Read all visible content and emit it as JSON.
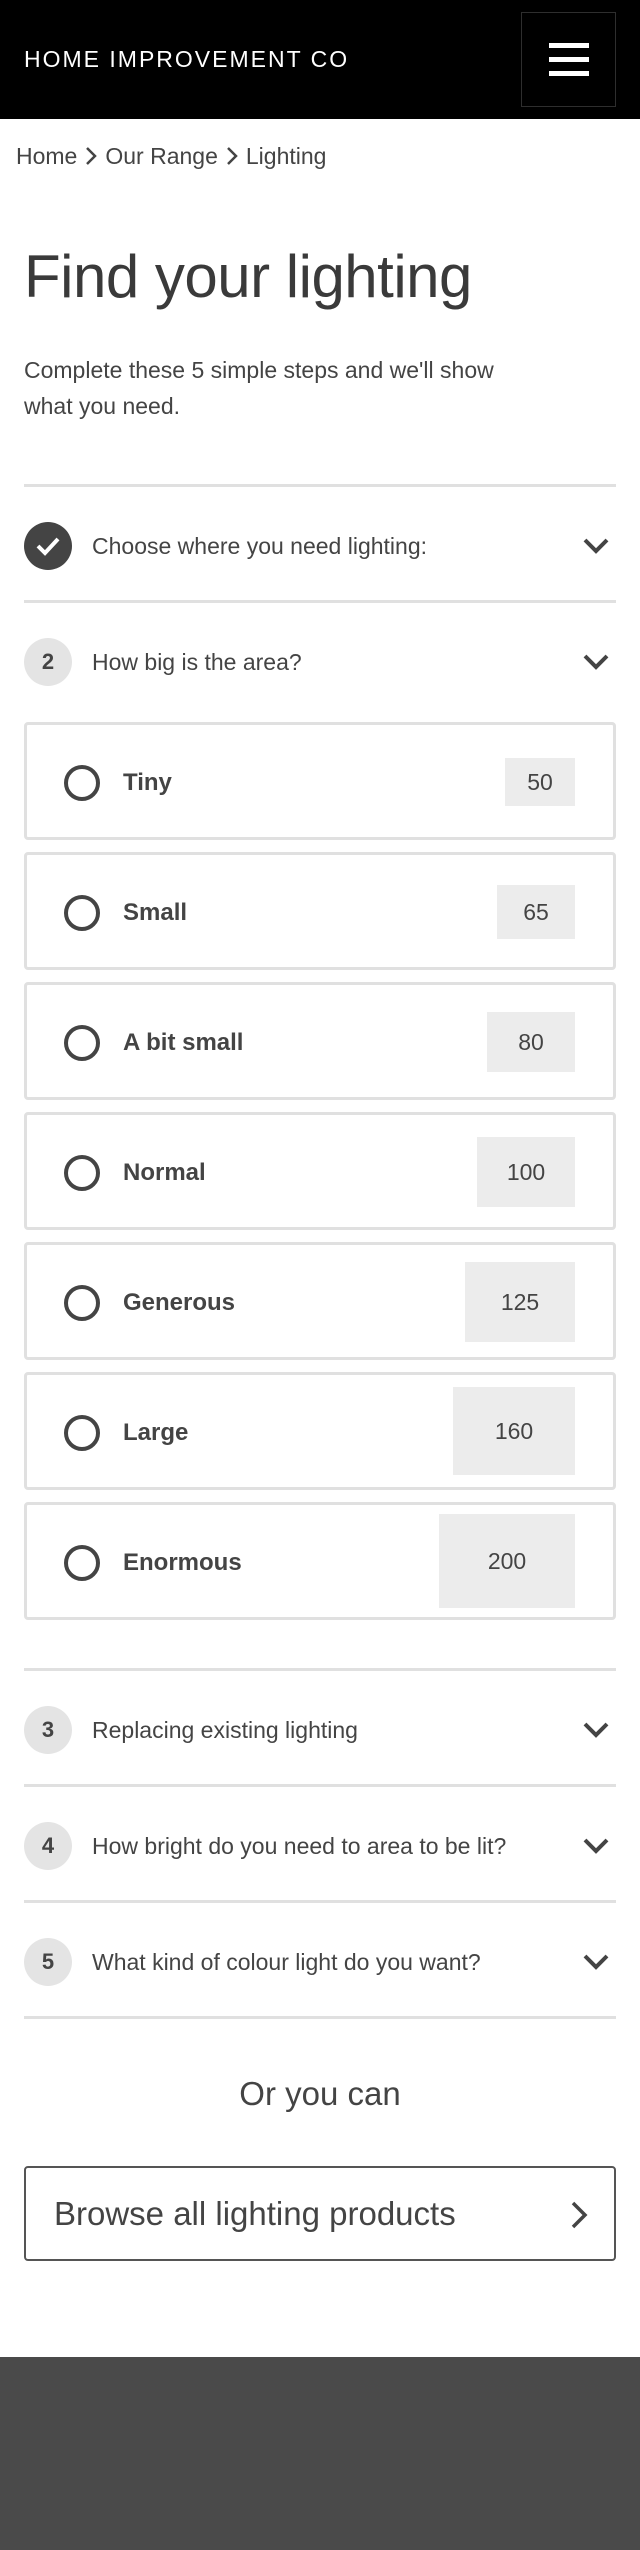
{
  "header": {
    "brand": "HOME IMPROVEMENT CO",
    "menu_icon": "hamburger-menu-icon"
  },
  "breadcrumb": {
    "items": [
      "Home",
      "Our Range",
      "Lighting"
    ],
    "separator_icon": "chevron-right-icon"
  },
  "page": {
    "title": "Find your lighting",
    "intro": "Complete these 5 simple steps and we'll show what you need."
  },
  "steps": [
    {
      "badge": "",
      "badge_icon": "checkmark-icon",
      "completed": true,
      "label": "Choose where you need lighting:",
      "expanded": false
    },
    {
      "badge": "2",
      "completed": false,
      "label": "How big is the area?",
      "expanded": true
    },
    {
      "badge": "3",
      "completed": false,
      "label": "Replacing existing lighting",
      "expanded": false
    },
    {
      "badge": "4",
      "completed": false,
      "label": "How bright do you need to area to be lit?",
      "expanded": false
    },
    {
      "badge": "5",
      "completed": false,
      "label": "What kind of colour light do you want?",
      "expanded": false
    }
  ],
  "area_options": [
    {
      "label": "Tiny",
      "value": "50"
    },
    {
      "label": "Small",
      "value": "65"
    },
    {
      "label": "A bit small",
      "value": "80"
    },
    {
      "label": "Normal",
      "value": "100"
    },
    {
      "label": "Generous",
      "value": "125"
    },
    {
      "label": "Large",
      "value": "160"
    },
    {
      "label": "Enormous",
      "value": "200"
    }
  ],
  "alternative": {
    "or_text": "Or you can",
    "browse_label": "Browse all lighting products",
    "browse_icon": "chevron-right-icon"
  },
  "colors": {
    "header_bg": "#000000",
    "text": "#444444",
    "divider": "#e0e0e0",
    "value_box": "#ececec",
    "footer_bg": "#4a4a4a"
  }
}
